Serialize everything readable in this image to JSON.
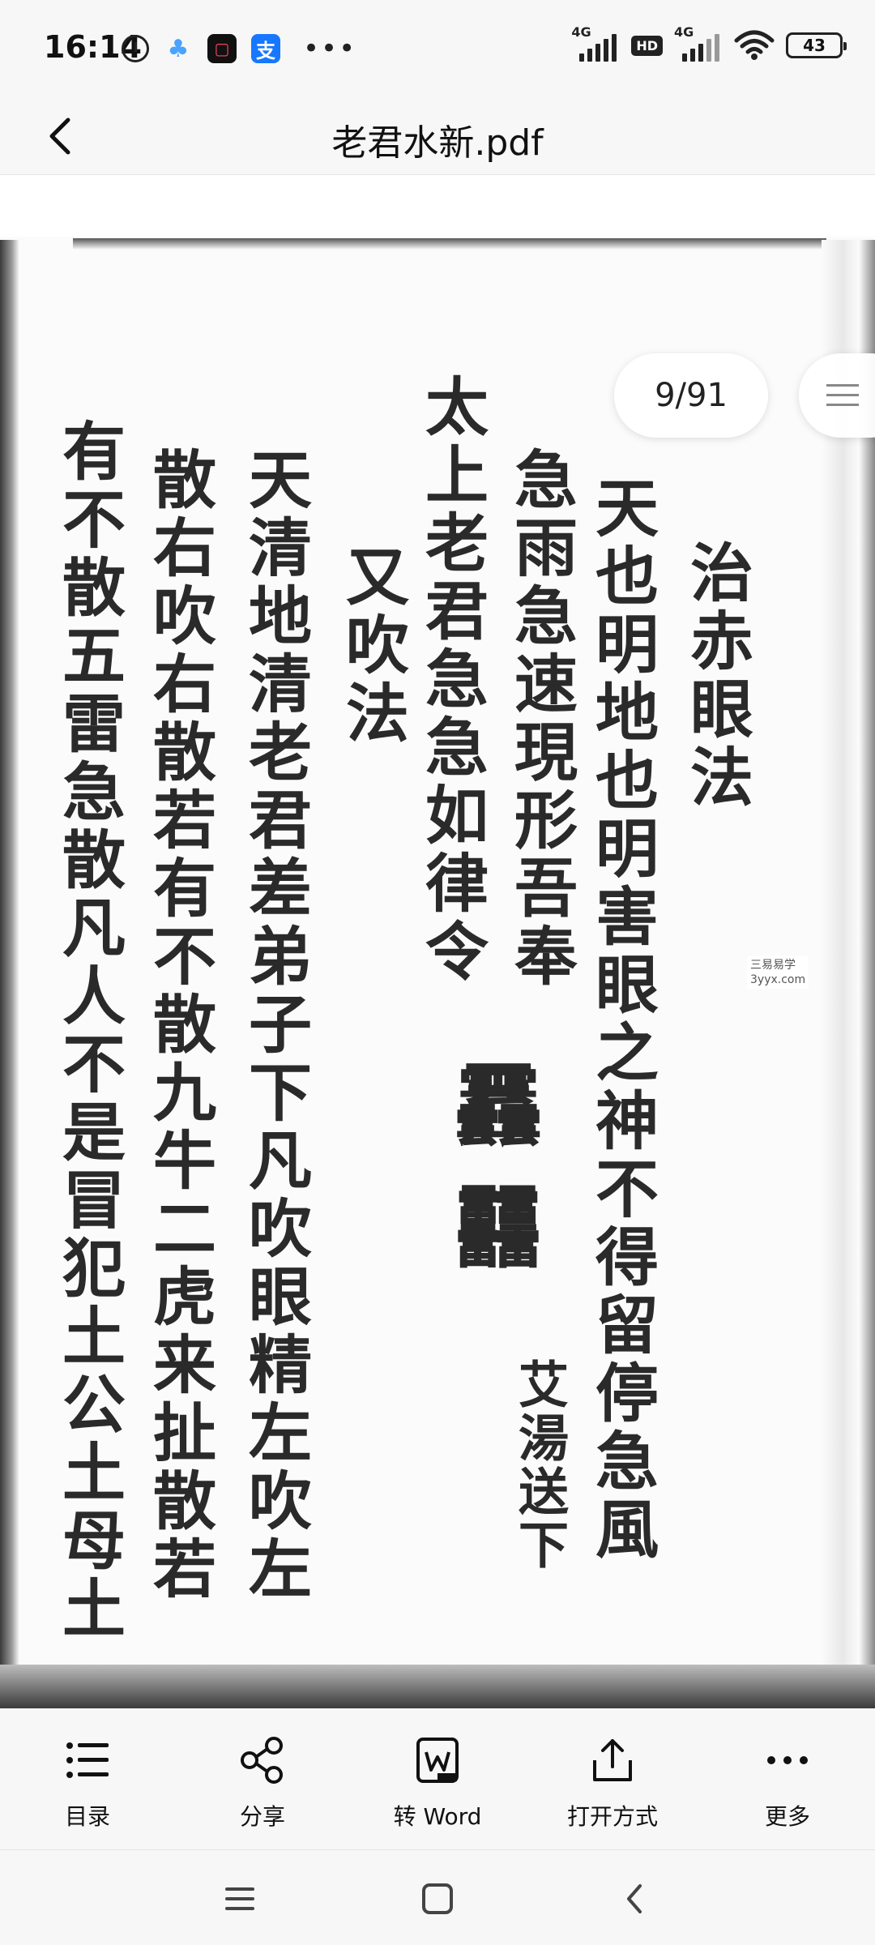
{
  "status_bar": {
    "time": "16:14",
    "network_1": "4G",
    "hd": "HD",
    "network_2": "4G",
    "battery": "43"
  },
  "header": {
    "title": "老君水新.pdf"
  },
  "viewer": {
    "page_indicator": "9/91",
    "watermark": [
      "三易易学",
      "3yyx.com"
    ],
    "columns": [
      "治赤眼法",
      "天也明地也明害眼之神不得留停急風",
      "急雨急速現形吾奉",
      "太上老君急急如律令",
      "艾湯送下",
      "又吹法",
      "天清地清老君差弟子下凡吹眼精左吹左",
      "散右吹右散若有不散九牛二虎来扯散若",
      "有不散五雷急散凡人不是冒犯土公土母土"
    ],
    "talisman": [
      "䨺",
      "䨻"
    ]
  },
  "toolbar": {
    "items": [
      {
        "label": "目录",
        "icon": "list-icon"
      },
      {
        "label": "分享",
        "icon": "share-icon"
      },
      {
        "label": "转 Word",
        "icon": "word-icon"
      },
      {
        "label": "打开方式",
        "icon": "open-with-icon"
      },
      {
        "label": "更多",
        "icon": "more-icon"
      }
    ]
  }
}
